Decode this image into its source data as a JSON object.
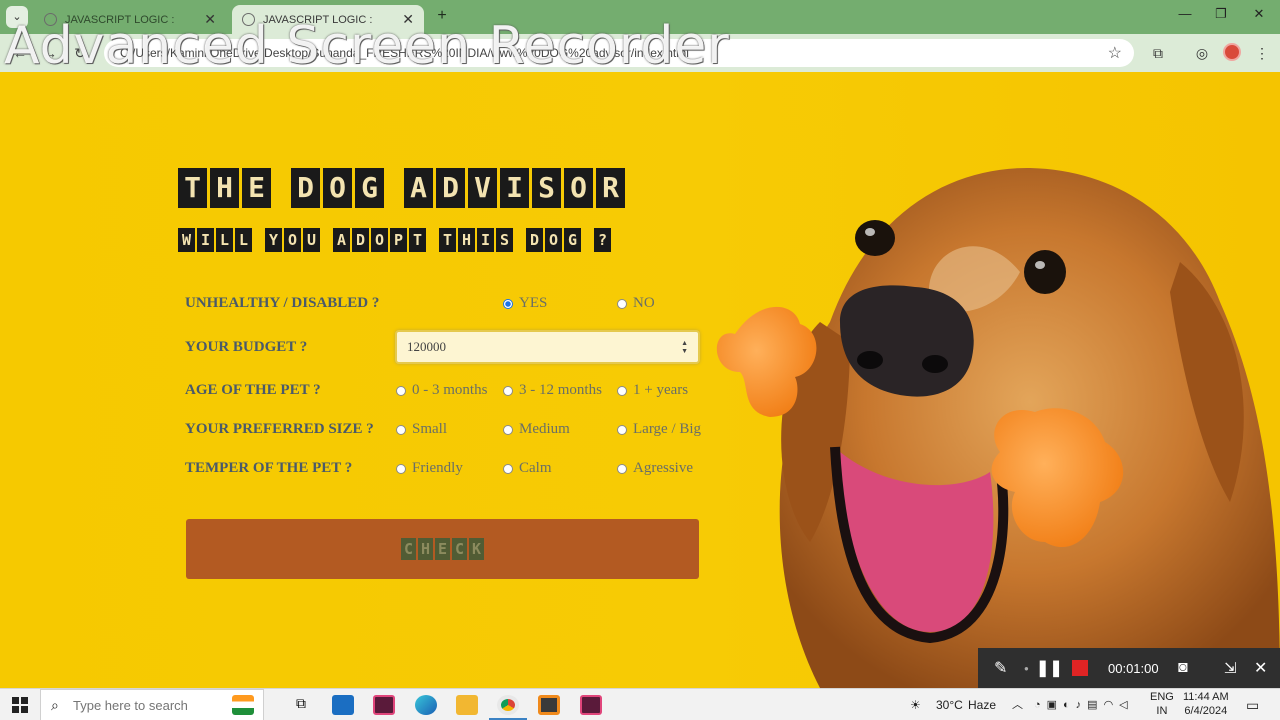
{
  "browser": {
    "tabs": [
      {
        "title": "JAVASCRIPT LOGIC :",
        "active": false
      },
      {
        "title": "JAVASCRIPT LOGIC :",
        "active": true
      }
    ],
    "url": "C:/Users/Kamini/OneDrive/Desktop/Sunanda_FRESHERS%20INDIA/www%20DOG%20advisor/index.html",
    "watermark": "Advanced Screen Recorder"
  },
  "app": {
    "title_words": [
      "THE",
      "DOG",
      "ADVISOR"
    ],
    "subtitle_words": [
      "WILL",
      "YOU",
      "ADOPT",
      "THIS",
      "DOG",
      "?"
    ],
    "check_label": "CHECK",
    "questions": [
      {
        "label": "UNHEALTHY / DISABLED ?",
        "options": [
          "YES",
          "NO"
        ],
        "selected": 0
      },
      {
        "label": "YOUR BUDGET ?",
        "input_value": "120000"
      },
      {
        "label": "AGE OF THE PET ?",
        "options": [
          "0 - 3 months",
          "3 - 12 months",
          "1 + years"
        ],
        "selected": -1
      },
      {
        "label": "YOUR PREFERRED SIZE ?",
        "options": [
          "Small",
          "Medium",
          "Large / Big"
        ],
        "selected": -1
      },
      {
        "label": "TEMPER OF THE PET ?",
        "options": [
          "Friendly",
          "Calm",
          "Agressive"
        ],
        "selected": -1
      }
    ]
  },
  "recorder": {
    "time": "00:01:00"
  },
  "taskbar": {
    "search_placeholder": "Type here to search",
    "weather_temp": "30°C",
    "weather_desc": "Haze",
    "lang_top": "ENG",
    "lang_bottom": "IN",
    "time": "11:44 AM",
    "date": "6/4/2024"
  },
  "colors": {
    "page_bg": "#f6c900",
    "check_button": "#b35a22",
    "tabbar": "#74ad6f",
    "toolbar": "#dcebd7"
  }
}
